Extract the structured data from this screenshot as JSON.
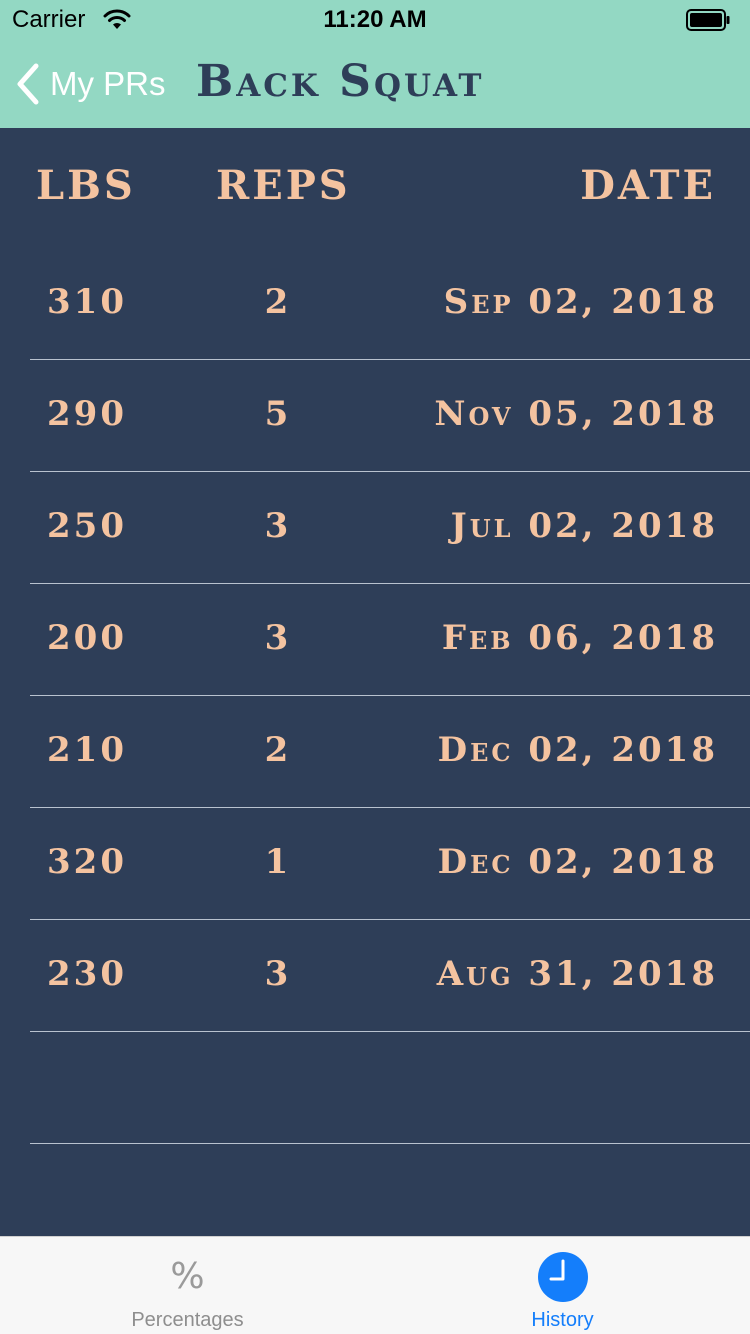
{
  "status_bar": {
    "carrier": "Carrier",
    "time": "11:20 AM"
  },
  "nav": {
    "back_label": "My PRs",
    "title": "Back Squat"
  },
  "table": {
    "headers": {
      "lbs": "LBS",
      "reps": "REPS",
      "date": "DATE"
    },
    "rows": [
      {
        "lbs": "310",
        "reps": "2",
        "date": "Sep 02, 2018"
      },
      {
        "lbs": "290",
        "reps": "5",
        "date": "Nov 05, 2018"
      },
      {
        "lbs": "250",
        "reps": "3",
        "date": "Jul 02, 2018"
      },
      {
        "lbs": "200",
        "reps": "3",
        "date": "Feb 06, 2018"
      },
      {
        "lbs": "210",
        "reps": "2",
        "date": "Dec 02, 2018"
      },
      {
        "lbs": "320",
        "reps": "1",
        "date": "Dec 02, 2018"
      },
      {
        "lbs": "230",
        "reps": "3",
        "date": "Aug 31, 2018"
      },
      {
        "lbs": "",
        "reps": "",
        "date": ""
      }
    ]
  },
  "tabbar": {
    "tabs": [
      {
        "label": "Percentages",
        "icon": "percent-icon",
        "active": false
      },
      {
        "label": "History",
        "icon": "clock-icon",
        "active": true
      }
    ],
    "percent_glyph": "%"
  },
  "colors": {
    "header_bg": "#93d8c3",
    "body_bg": "#2e3e58",
    "accent_text": "#f4c3a0",
    "title_text": "#2e3e58",
    "tab_active": "#147efb",
    "tab_inactive": "#8e8e8e"
  }
}
